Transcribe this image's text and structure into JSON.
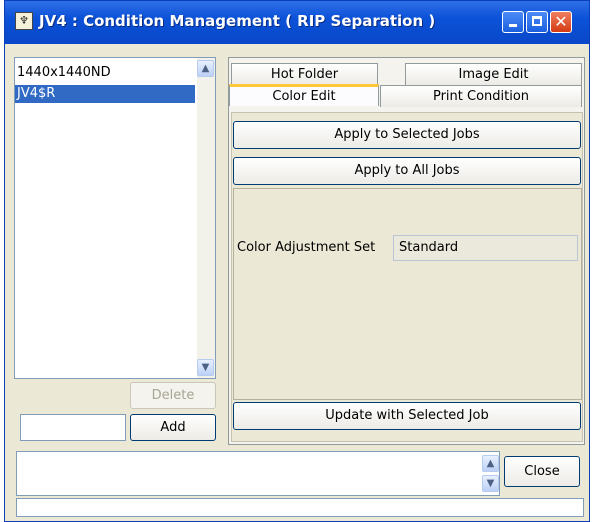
{
  "window": {
    "title": "JV4 : Condition Management ( RIP Separation )"
  },
  "condition_list": {
    "items": [
      {
        "label": "1440x1440ND",
        "selected": false
      },
      {
        "label": "JV4$R",
        "selected": true
      }
    ]
  },
  "left_buttons": {
    "delete_label": "Delete",
    "add_label": "Add",
    "add_field_value": ""
  },
  "tabs": {
    "row1": [
      "Hot Folder",
      "Image Edit"
    ],
    "row2": [
      "Color Edit",
      "Print Condition"
    ],
    "active": "Color Edit"
  },
  "color_edit": {
    "apply_selected_label": "Apply to Selected Jobs",
    "apply_all_label": "Apply to All Jobs",
    "adjustment_set_label": "Color Adjustment Set",
    "adjustment_set_value": "Standard",
    "update_label": "Update with Selected Job"
  },
  "bottom": {
    "message": "",
    "close_label": "Close",
    "status": ""
  },
  "colors": {
    "titlebar": "#0b52d8",
    "selection": "#316ac5",
    "window_bg": "#ebe8d6",
    "active_tab_accent": "#ffc83c"
  }
}
